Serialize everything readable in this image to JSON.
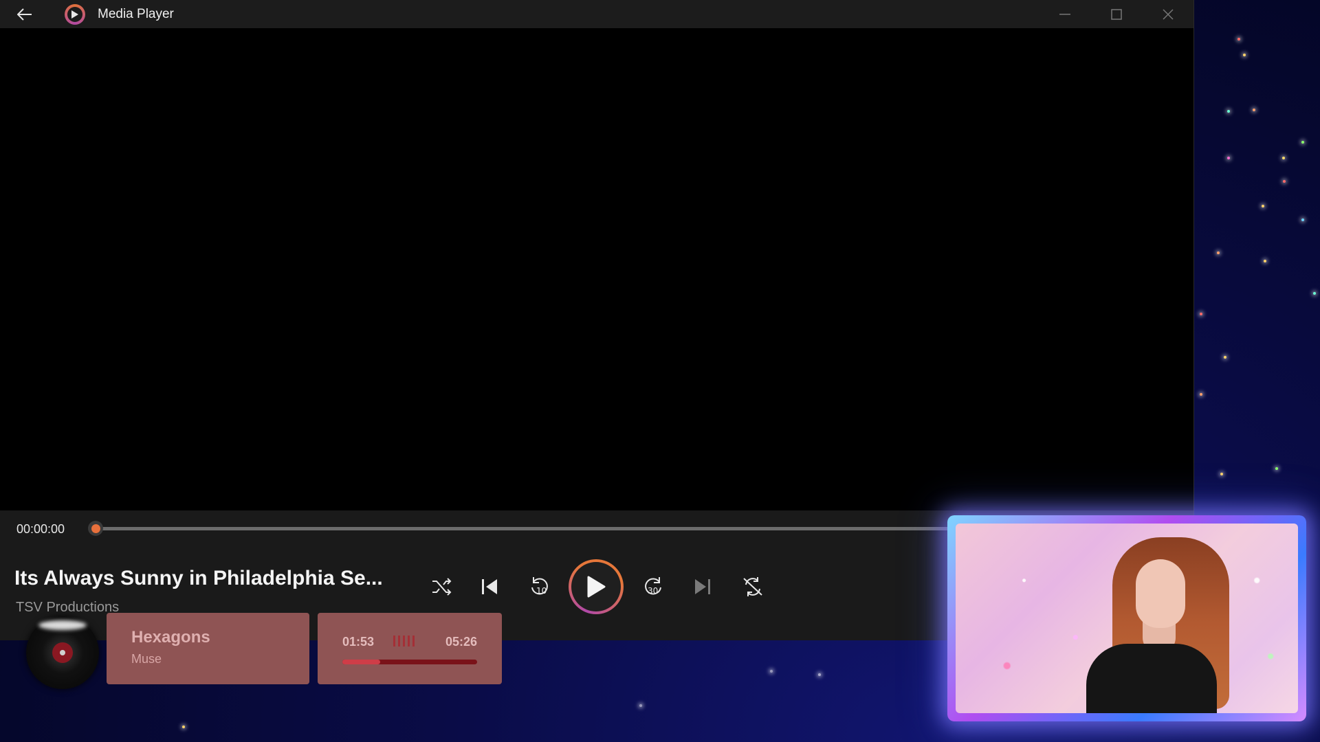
{
  "window": {
    "title": "Media Player",
    "accent": "#e8703c"
  },
  "player": {
    "current_time": "00:00:00",
    "progress": 0,
    "media_title": "Its Always Sunny in Philadelphia Se...",
    "media_subtitle": "TSV Productions",
    "controls": {
      "shuffle_icon": "shuffle-icon",
      "previous_icon": "skip-previous-icon",
      "rewind_label": "10",
      "play_icon": "play-icon",
      "forward_label": "30",
      "next_icon": "skip-next-icon",
      "repeat_icon": "repeat-off-icon"
    }
  },
  "now_playing": {
    "song": "Hexagons",
    "artist": "Muse",
    "elapsed": "01:53",
    "total": "05:26",
    "progress": 0.28,
    "card_color": "#8f5454"
  }
}
